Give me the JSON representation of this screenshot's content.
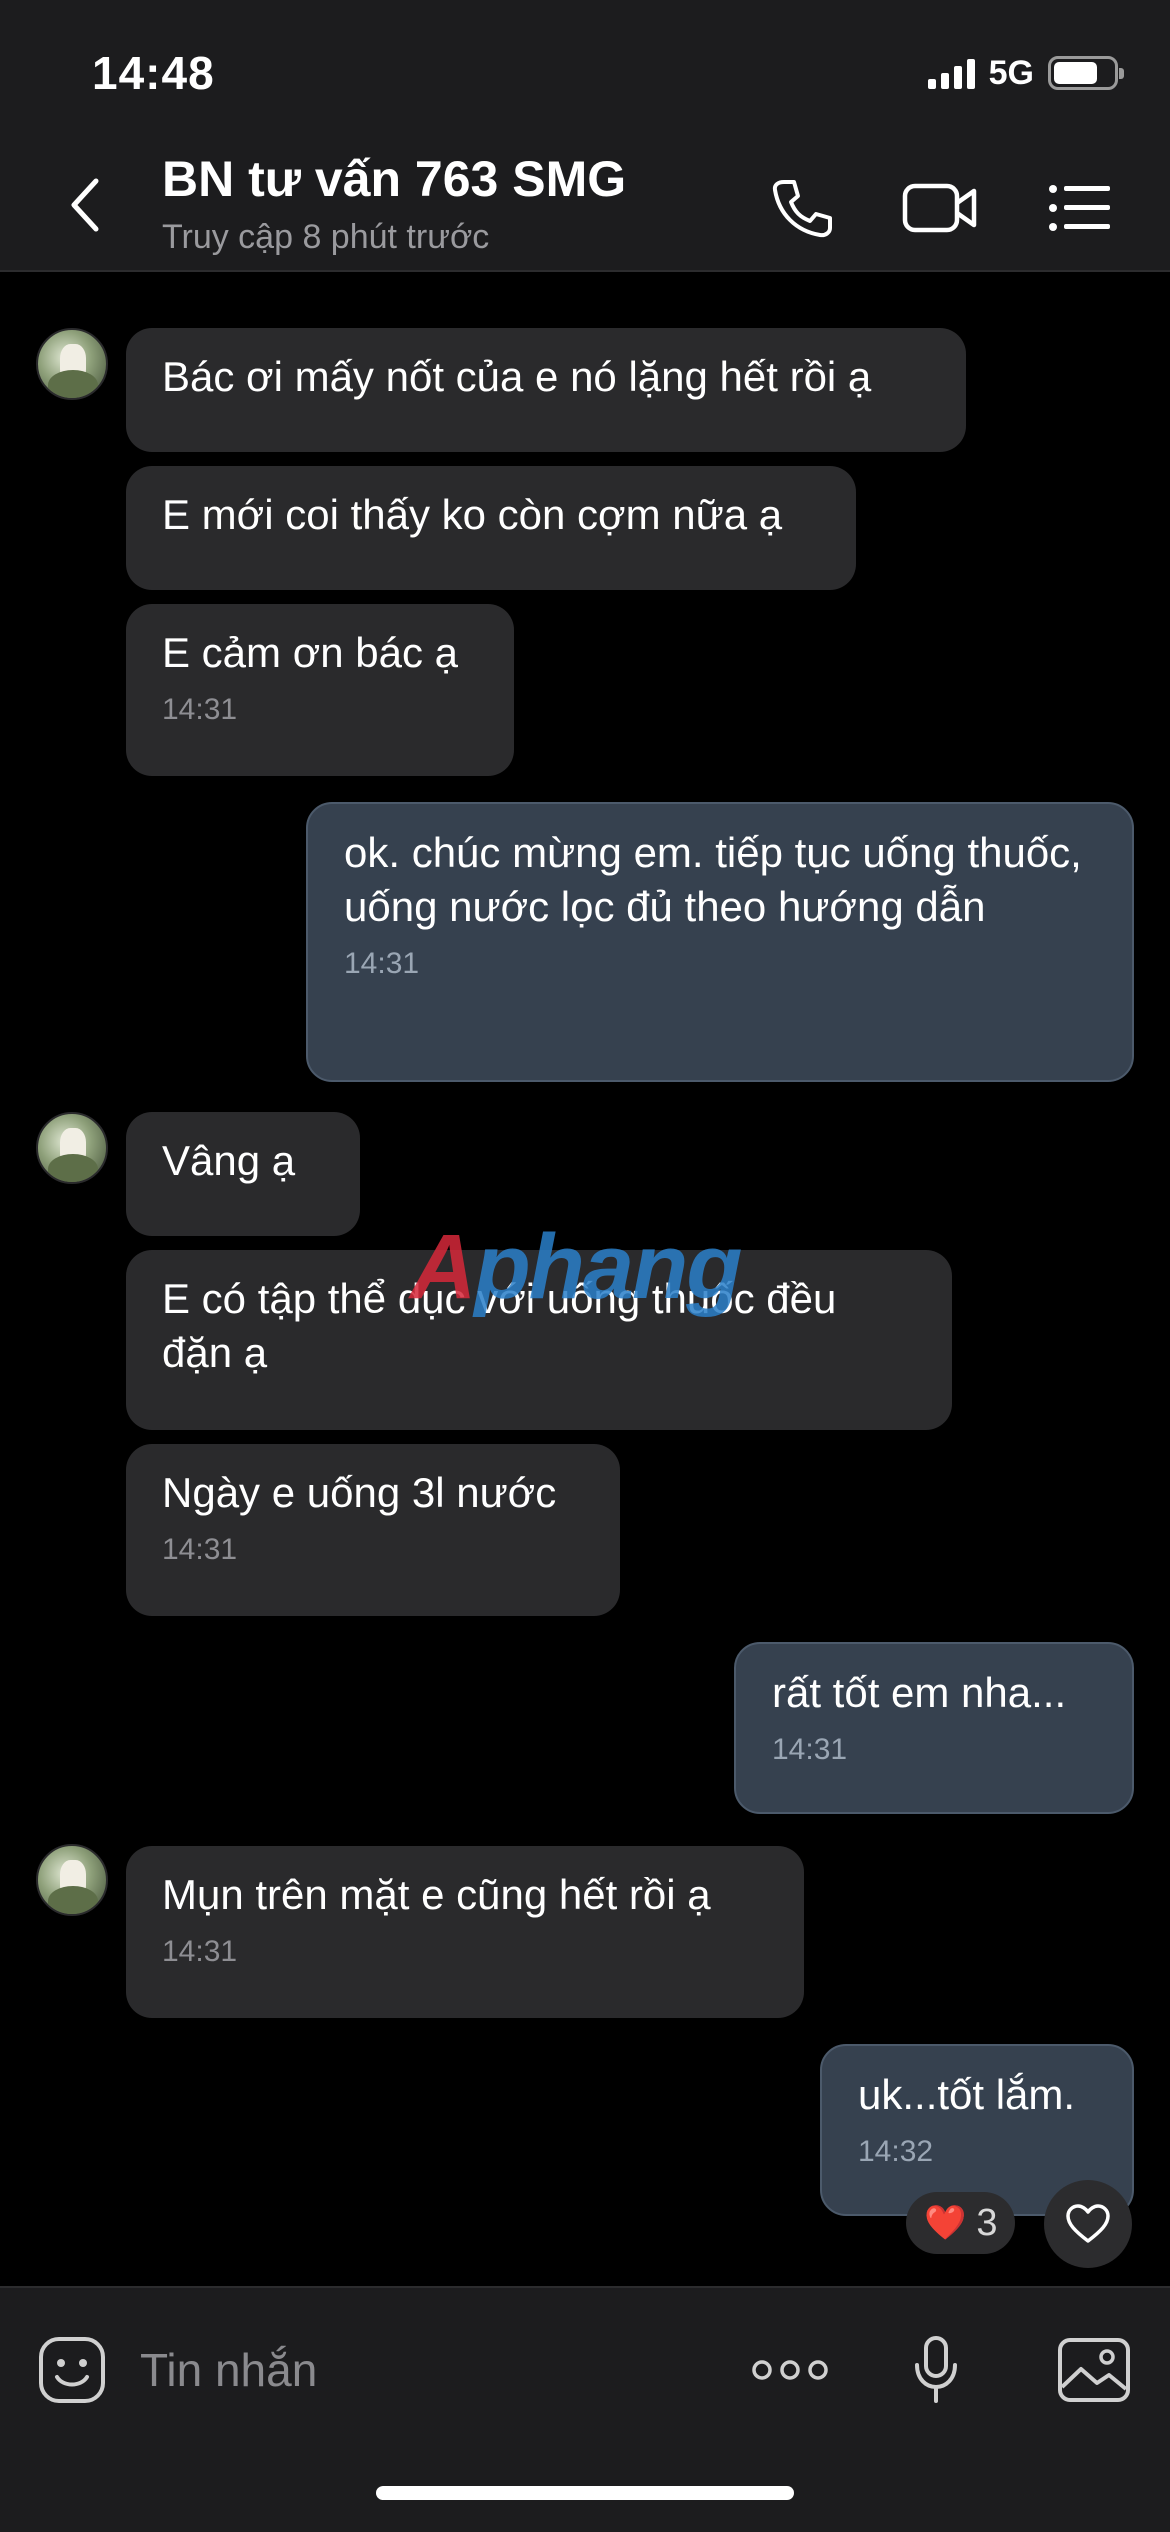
{
  "status": {
    "time": "14:48",
    "network": "5G",
    "battery_icon": "battery-icon",
    "signal_icon": "signal-icon"
  },
  "header": {
    "title": "BN tư vấn 763 SMG",
    "subtitle": "Truy cập 8 phút trước",
    "icons": [
      "back-chevron-icon",
      "phone-icon",
      "video-call-icon",
      "menu-list-icon"
    ]
  },
  "messages": [
    {
      "dir": "in",
      "text": "Bác ơi mấy nốt của e nó lặng hết rồi ạ"
    },
    {
      "dir": "in",
      "text": "E mới coi thấy ko còn cợm nữa ạ"
    },
    {
      "dir": "in",
      "text": "E cảm ơn bác ạ",
      "time": "14:31"
    },
    {
      "dir": "out",
      "text": "ok. chúc mừng em. tiếp tục uống thuốc, uống nước lọc đủ theo hướng dẫn",
      "time": "14:31"
    },
    {
      "dir": "in",
      "text": "Vâng ạ"
    },
    {
      "dir": "in",
      "text": "E có tập thể dục với uống thuốc đều đặn ạ"
    },
    {
      "dir": "in",
      "text": "Ngày e uống 3l nước",
      "time": "14:31"
    },
    {
      "dir": "out",
      "text": "rất tốt em nha...",
      "time": "14:31"
    },
    {
      "dir": "in",
      "text": "Mụn trên mặt e cũng hết rồi ạ",
      "time": "14:31"
    },
    {
      "dir": "out",
      "text": "uk...tốt lắm.",
      "time": "14:32"
    }
  ],
  "reaction": {
    "emoji": "❤️",
    "count": "3"
  },
  "watermark": {
    "part1": "A",
    "part2": "phang"
  },
  "input": {
    "placeholder": "Tin nhắn"
  },
  "colors": {
    "incoming": "#2a2a2c",
    "outgoing": "#36414f",
    "background": "#000000",
    "bar": "#1c1c1e"
  }
}
